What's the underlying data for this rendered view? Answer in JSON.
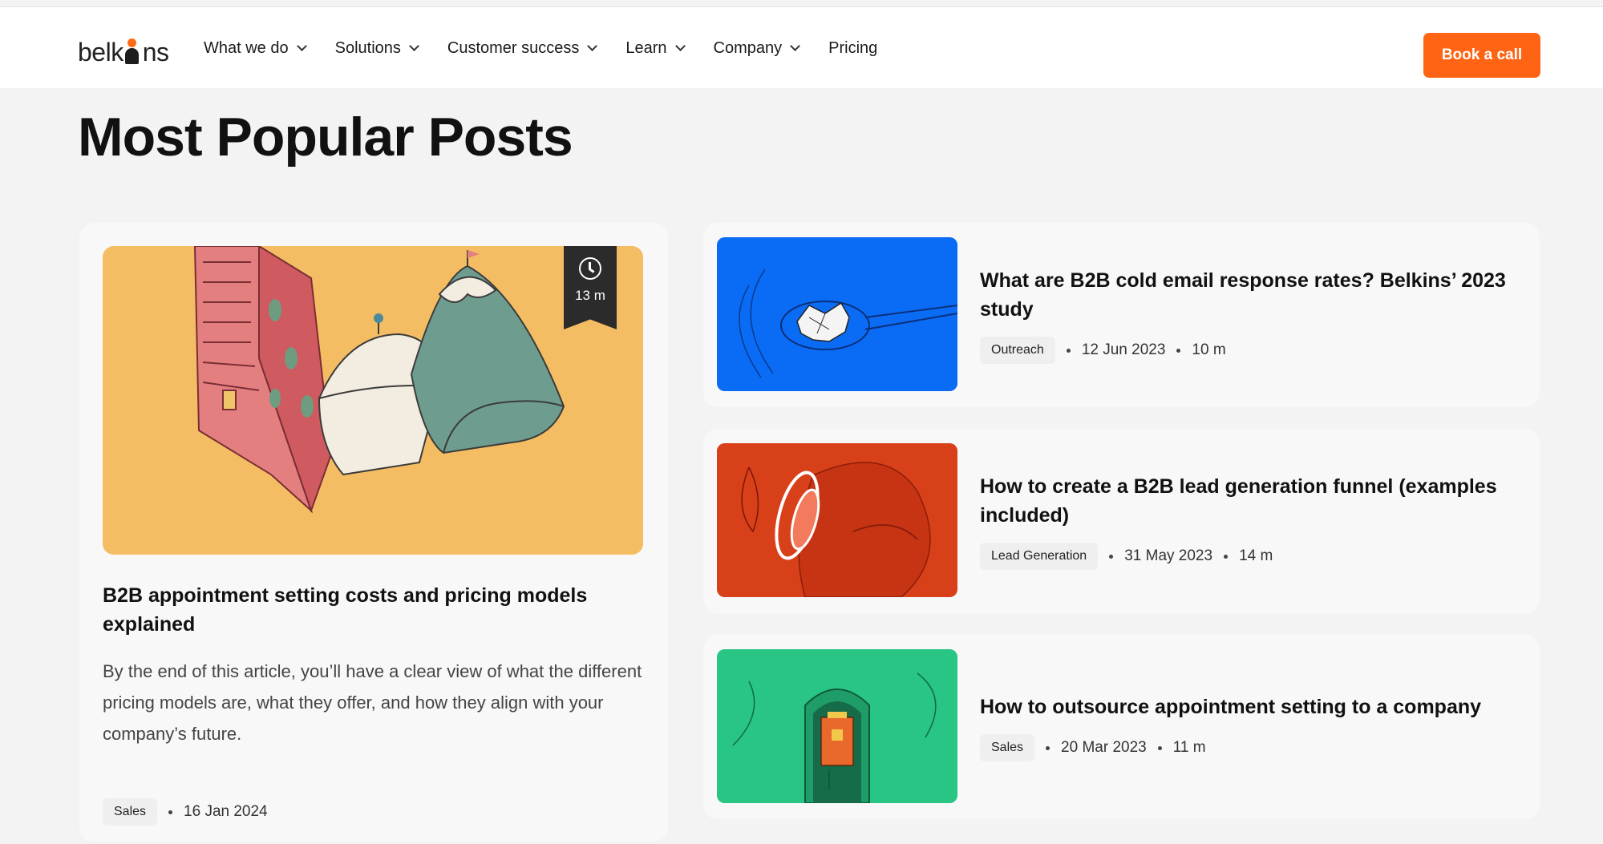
{
  "header": {
    "logo_text": "belkins",
    "nav": [
      {
        "label": "What we do",
        "has_dropdown": true
      },
      {
        "label": "Solutions",
        "has_dropdown": true
      },
      {
        "label": "Customer success",
        "has_dropdown": true
      },
      {
        "label": "Learn",
        "has_dropdown": true
      },
      {
        "label": "Company",
        "has_dropdown": true
      },
      {
        "label": "Pricing",
        "has_dropdown": false
      }
    ],
    "cta_label": "Book a call"
  },
  "page_title": "Most Popular Posts",
  "featured": {
    "reading_time": "13 m",
    "title": "B2B appointment setting costs and pricing models explained",
    "excerpt": "By the end of this article, you’ll have a clear view of what the different pricing models are, what they offer, and how they align with your company’s future.",
    "tag": "Sales",
    "date": "16 Jan 2024"
  },
  "posts": [
    {
      "title": "What are B2B cold email response rates? Belkins’ 2023 study",
      "tag": "Outreach",
      "date": "12 Jun 2023",
      "reading_time": "10 m",
      "image_color": "#0a6cf5"
    },
    {
      "title": "How to create a B2B lead generation funnel (examples included)",
      "tag": "Lead Generation",
      "date": "31 May 2023",
      "reading_time": "14 m",
      "image_color": "#d8401a"
    },
    {
      "title": "How to outsource appointment setting to a company",
      "tag": "Sales",
      "date": "20 Mar 2023",
      "reading_time": "11 m",
      "image_color": "#29c584"
    }
  ],
  "colors": {
    "accent": "#ff6414",
    "featured_image_bg": "#f5bd63"
  }
}
